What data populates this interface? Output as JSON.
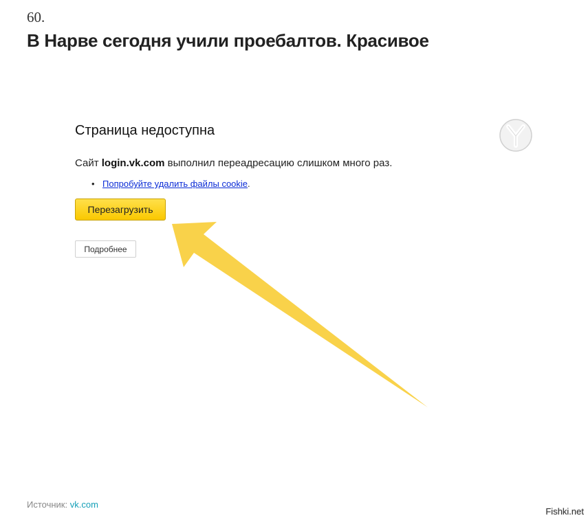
{
  "post": {
    "number": "60.",
    "title": "В Нарве сегодня учили проебалтов. Красивое"
  },
  "error_page": {
    "heading": "Страница недоступна",
    "message_prefix": "Сайт",
    "domain": "login.vk.com",
    "message_suffix": "выполнил переадресацию слишком много раз.",
    "suggestion_link": "Попробуйте удалить файлы cookie",
    "suggestion_end": ".",
    "reload_label": "Перезагрузить",
    "details_label": "Подробнее",
    "browser_logo_icon": "yandex-browser-logo-icon"
  },
  "annotation": {
    "arrow_color": "#f9d24a"
  },
  "footer": {
    "source_label": "Источник:",
    "source_link": "vk.com",
    "watermark": "Fishki.net"
  },
  "colors": {
    "reload_button": "#fcd20a",
    "link": "#0a2bd6",
    "source_link": "#16a0b8"
  }
}
